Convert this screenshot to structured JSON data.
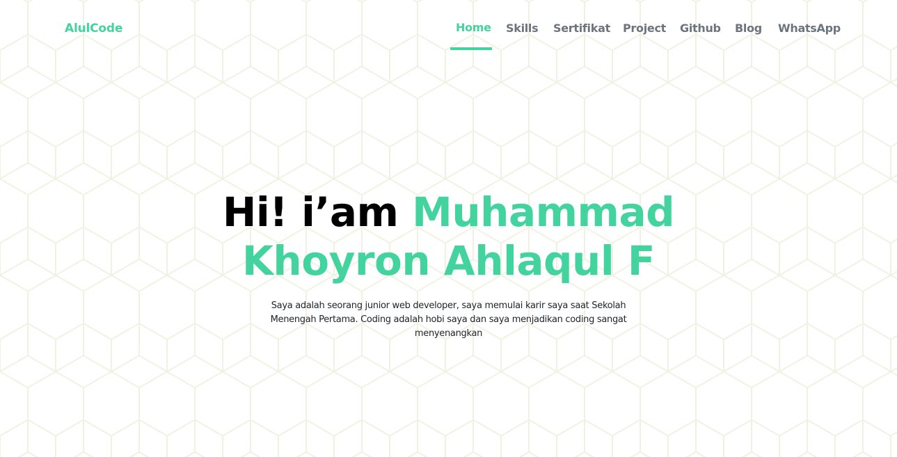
{
  "brand": {
    "name": "AlulCode"
  },
  "nav": {
    "items": [
      {
        "label": "Home",
        "active": true
      },
      {
        "label": "Skills",
        "active": false
      },
      {
        "label": "Sertifikat",
        "active": false
      },
      {
        "label": "Project",
        "active": false
      },
      {
        "label": "Github",
        "active": false
      },
      {
        "label": "Blog",
        "active": false
      },
      {
        "label": "WhatsApp",
        "active": false
      }
    ]
  },
  "hero": {
    "greeting": "Hi! i’am",
    "name_line1": "Muhammad",
    "name_line2": "Khoyron Ahlaqul F",
    "description": "Saya adalah seorang junior web developer, saya memulai karir saya saat Sekolah Menengah Pertama. Coding adalah hobi saya dan saya menjadikan coding sangat menyenangkan"
  },
  "colors": {
    "accent": "#43d39e",
    "nav_text": "#6c757d",
    "title": "#000000",
    "pattern_stroke": "#f3f3e6"
  }
}
